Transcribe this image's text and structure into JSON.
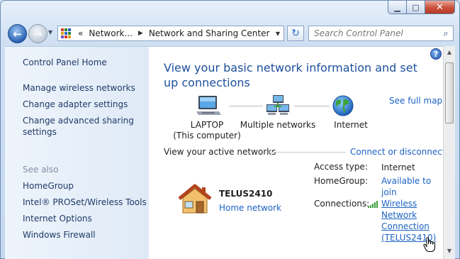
{
  "window": {
    "minimize_glyph": "▁",
    "maximize_glyph": "▢",
    "close_glyph": "✕"
  },
  "nav": {
    "back_glyph": "←",
    "forward_glyph": "→",
    "recent_glyph": "▼"
  },
  "address": {
    "overflow": "«",
    "crumbs": [
      "Network...",
      "Network and Sharing Center"
    ],
    "separator": "▶",
    "dropdown_glyph": "▼",
    "icon_colors": [
      "#d63b2a",
      "#2c8a2e",
      "#3361c2",
      "#e0a21c",
      "#3361c2",
      "#2c8a2e",
      "#7a4bb5",
      "#d63b2a",
      "#e0a21c"
    ]
  },
  "refresh_glyph": "↻",
  "search": {
    "placeholder": "Search Control Panel",
    "icon_glyph": "⌕"
  },
  "sidebar": {
    "home": "Control Panel Home",
    "tasks": [
      "Manage wireless networks",
      "Change adapter settings",
      "Change advanced sharing settings"
    ],
    "see_also_label": "See also",
    "see_also": [
      "HomeGroup",
      "Intel® PROSet/Wireless Tools",
      "Internet Options",
      "Windows Firewall"
    ]
  },
  "help_glyph": "?",
  "main": {
    "heading": "View your basic network information and set up connections",
    "see_full_map": "See full map",
    "map": {
      "computer_label": "LAPTOP",
      "computer_sub": "(This computer)",
      "network_label": "Multiple networks",
      "internet_label": "Internet"
    },
    "active_networks_label": "View your active networks",
    "connect_link": "Connect or disconnect",
    "network": {
      "name": "TELUS2410",
      "type": "Home network"
    },
    "properties": {
      "access_type_label": "Access type:",
      "access_type_value": "Internet",
      "homegroup_label": "HomeGroup:",
      "homegroup_value_line1": "Available to",
      "homegroup_value_line2": "join",
      "connections_label": "Connections:",
      "connection_lines": [
        "Wireless",
        "Network",
        "Connection",
        "(TELUS2410)"
      ]
    }
  },
  "colors": {
    "link": "#1b62c4",
    "heading": "#1d4f9c",
    "sidebar_link": "#1f3a66",
    "muted": "#8190a5"
  }
}
